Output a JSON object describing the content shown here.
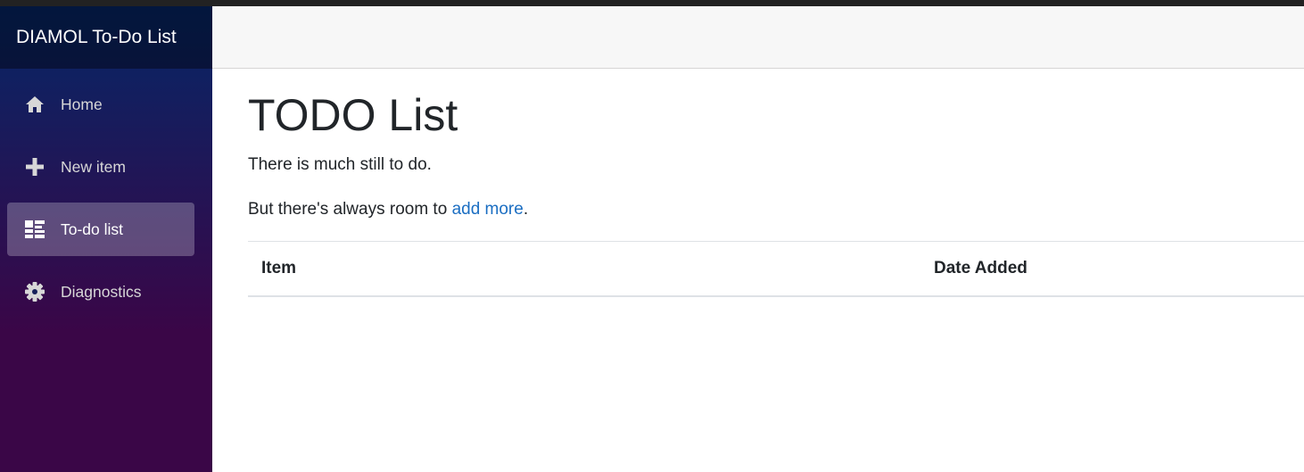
{
  "app": {
    "brand": "DIAMOL To-Do List"
  },
  "sidebar": {
    "items": [
      {
        "label": "Home",
        "icon": "home-icon",
        "active": false
      },
      {
        "label": "New item",
        "icon": "plus-icon",
        "active": false
      },
      {
        "label": "To-do list",
        "icon": "list-icon",
        "active": true
      },
      {
        "label": "Diagnostics",
        "icon": "gear-icon",
        "active": false
      }
    ]
  },
  "main": {
    "title": "TODO List",
    "lead": "There is much still to do.",
    "prompt_prefix": "But there's always room to ",
    "prompt_link": "add more",
    "prompt_suffix": ".",
    "table": {
      "headers": [
        "Item",
        "Date Added"
      ],
      "rows": []
    }
  },
  "colors": {
    "sidebar_top": "#052767",
    "sidebar_bottom": "#3a0647",
    "link": "#1b6ec2"
  }
}
